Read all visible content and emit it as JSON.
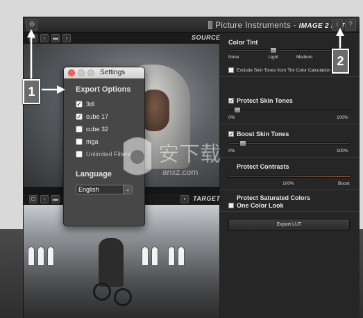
{
  "app": {
    "brand": "Picture Instruments",
    "product": "IMAGE 2 LUT",
    "info_btn": "i",
    "help_btn": "?"
  },
  "viewer": {
    "source_label": "SOURCE",
    "target_label": "TARGET"
  },
  "panel": {
    "color_tint": {
      "title": "Color Tint",
      "ticks": [
        "None",
        "Light",
        "Medium"
      ],
      "exclude_label": "Exclude Skin Tones from Tint Color Calculation"
    },
    "protect_skin": {
      "title": "Protect Skin Tones",
      "min": "0%",
      "max": "100%"
    },
    "boost_skin": {
      "title": "Boost Skin Tones",
      "min": "0%",
      "max": "100%"
    },
    "protect_contrasts": {
      "title": "Protect Contrasts",
      "mid": "100%",
      "max": "Boost"
    },
    "protect_saturated": {
      "title": "Protect Saturated Colors"
    },
    "one_color": {
      "title": "One Color Look"
    },
    "export_label": "Export LUT"
  },
  "settings": {
    "title": "Settings",
    "export_heading": "Export Options",
    "options": [
      {
        "label": "3dl",
        "checked": true
      },
      {
        "label": "cube 17",
        "checked": true
      },
      {
        "label": "cube 32",
        "checked": false
      },
      {
        "label": "mga",
        "checked": false
      },
      {
        "label": "Unlimited Filters",
        "checked": false
      }
    ],
    "language_heading": "Language",
    "language_value": "English"
  },
  "callouts": {
    "one": "1",
    "two": "2"
  },
  "colors": {
    "panel_bg": "#262626",
    "dialog_bg": "#474747",
    "contrast_accent": "#c0603a",
    "callout_bg": "#6b6b6b"
  }
}
